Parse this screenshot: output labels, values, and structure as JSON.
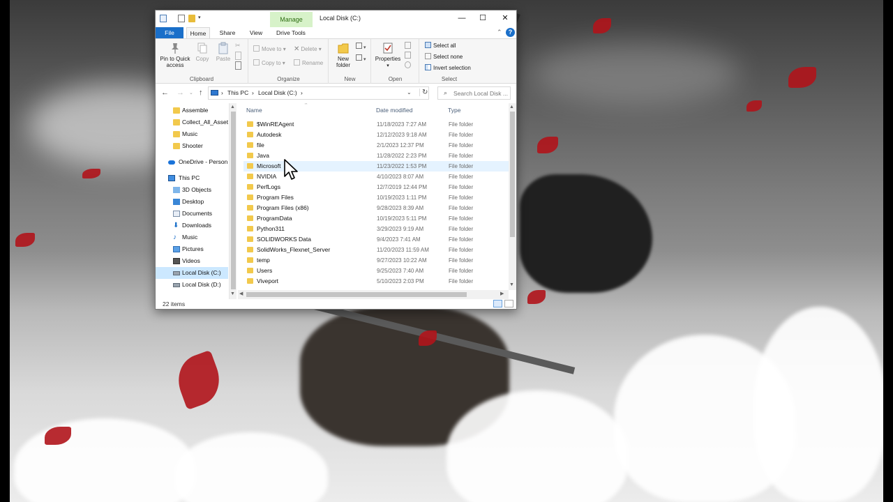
{
  "window": {
    "title": "Local Disk (C:)",
    "manage_tab": "Manage",
    "minimize": "—",
    "maximize": "☐",
    "close": "✕"
  },
  "ribbon": {
    "tabs": {
      "file": "File",
      "home": "Home",
      "share": "Share",
      "view": "View",
      "drive_tools": "Drive Tools"
    },
    "collapse": "⌃",
    "help": "?",
    "clipboard": {
      "label": "Clipboard",
      "pin_line1": "Pin to Quick",
      "pin_line2": "access",
      "copy": "Copy",
      "paste": "Paste"
    },
    "organize": {
      "label": "Organize",
      "move_to": "Move to",
      "copy_to": "Copy to",
      "delete": "Delete",
      "rename": "Rename"
    },
    "new": {
      "label": "New",
      "new_line1": "New",
      "new_line2": "folder"
    },
    "open": {
      "label": "Open",
      "properties": "Properties"
    },
    "select": {
      "label": "Select",
      "select_all": "Select all",
      "select_none": "Select none",
      "invert": "Invert selection"
    }
  },
  "address": {
    "crumb_this_pc": "This PC",
    "crumb_local_disk": "Local Disk (C:)",
    "sep1": "›",
    "sep2": "›",
    "sep3": "›",
    "back": "←",
    "forward": "→",
    "recent": "⌄",
    "up": "↑",
    "dropdown": "⌄",
    "refresh": "↻"
  },
  "search": {
    "placeholder": "Search Local Disk ..."
  },
  "navpane": {
    "items": [
      {
        "label": "Assemble"
      },
      {
        "label": "Collect_All_Asset"
      },
      {
        "label": "Music"
      },
      {
        "label": "Shooter"
      },
      {
        "label": "OneDrive - Person"
      },
      {
        "label": "This PC"
      },
      {
        "label": "3D Objects"
      },
      {
        "label": "Desktop"
      },
      {
        "label": "Documents"
      },
      {
        "label": "Downloads"
      },
      {
        "label": "Music"
      },
      {
        "label": "Pictures"
      },
      {
        "label": "Videos"
      },
      {
        "label": "Local Disk (C:)"
      },
      {
        "label": "Local Disk (D:)"
      }
    ],
    "selected_index": 13
  },
  "filelist": {
    "columns": {
      "name": "Name",
      "date": "Date modified",
      "type": "Type"
    },
    "sort_indicator": "^",
    "rows": [
      {
        "name": "$WinREAgent",
        "date": "11/18/2023 7:27 AM",
        "type": "File folder"
      },
      {
        "name": "Autodesk",
        "date": "12/12/2023 9:18 AM",
        "type": "File folder"
      },
      {
        "name": "file",
        "date": "2/1/2023 12:37 PM",
        "type": "File folder"
      },
      {
        "name": "Java",
        "date": "11/28/2022 2:23 PM",
        "type": "File folder"
      },
      {
        "name": "Microsoft",
        "date": "11/23/2022 1:53 PM",
        "type": "File folder"
      },
      {
        "name": "NVIDIA",
        "date": "4/10/2023 8:07 AM",
        "type": "File folder"
      },
      {
        "name": "PerfLogs",
        "date": "12/7/2019 12:44 PM",
        "type": "File folder"
      },
      {
        "name": "Program Files",
        "date": "10/19/2023 1:11 PM",
        "type": "File folder"
      },
      {
        "name": "Program Files (x86)",
        "date": "9/28/2023 8:39 AM",
        "type": "File folder"
      },
      {
        "name": "ProgramData",
        "date": "10/19/2023 5:11 PM",
        "type": "File folder"
      },
      {
        "name": "Python311",
        "date": "3/29/2023 9:19 AM",
        "type": "File folder"
      },
      {
        "name": "SOLIDWORKS Data",
        "date": "9/4/2023 7:41 AM",
        "type": "File folder"
      },
      {
        "name": "SolidWorks_Flexnet_Server",
        "date": "11/20/2023 11:59 AM",
        "type": "File folder"
      },
      {
        "name": "temp",
        "date": "9/27/2023 10:22 AM",
        "type": "File folder"
      },
      {
        "name": "Users",
        "date": "9/25/2023 7:40 AM",
        "type": "File folder"
      },
      {
        "name": "Viveport",
        "date": "5/10/2023 2:03 PM",
        "type": "File folder"
      }
    ],
    "hover_index": 4
  },
  "status": {
    "item_count": "22 items"
  },
  "colors": {
    "accent": "#1a6fc9",
    "manage_tab_bg": "#d7f2c9",
    "selection": "#cce8ff",
    "folder": "#f2c94c"
  }
}
